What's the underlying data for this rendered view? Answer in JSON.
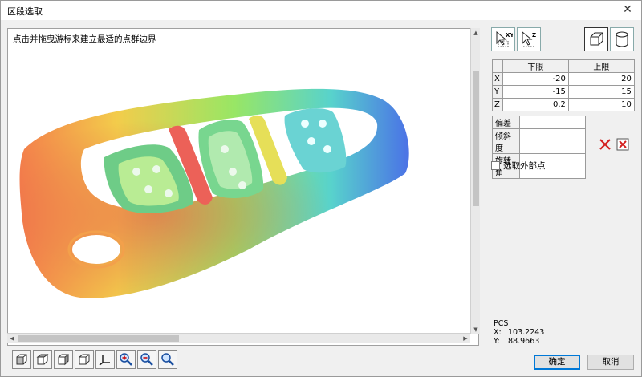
{
  "window": {
    "title": "区段选取",
    "close_glyph": "✕"
  },
  "viewer": {
    "hint": "点击并拖曳游标来建立最适的点群边界"
  },
  "scrollbars": {
    "up": "▲",
    "down": "▼",
    "left": "◀",
    "right": "▶"
  },
  "toolbar": {
    "icons": [
      "cube-front-icon",
      "cube-top-icon",
      "cube-left-icon",
      "cube-iso-icon",
      "axis-icon",
      "zoom-in-icon",
      "zoom-out-icon",
      "zoom-fit-icon"
    ]
  },
  "selection_mode": {
    "xy_label": "XY",
    "z_label": "Z",
    "shape_icons": [
      "cube-shape-icon",
      "cylinder-shape-icon"
    ]
  },
  "limits": {
    "header_lower": "下限",
    "header_upper": "上限",
    "rows": [
      {
        "axis": "X",
        "lower": "-20",
        "upper": "20"
      },
      {
        "axis": "Y",
        "lower": "-15",
        "upper": "15"
      },
      {
        "axis": "Z",
        "lower": "0.2",
        "upper": "10"
      }
    ]
  },
  "params": {
    "rows": [
      {
        "label": "偏差",
        "value": ""
      },
      {
        "label": "倾斜度",
        "value": ""
      },
      {
        "label": "旋转角",
        "value": ""
      }
    ]
  },
  "actions": {
    "delete_icon": "red-x-icon",
    "clear_icon": "red-boxed-x-icon"
  },
  "outside_points": {
    "label": "选取外部点",
    "checked": false
  },
  "coords": {
    "system": "PCS",
    "x_label": "X:",
    "x_value": "103.2243",
    "y_label": "Y:",
    "y_value": "88.9663"
  },
  "buttons": {
    "ok": "确定",
    "cancel": "取消"
  },
  "colors": {
    "accent": "#0078d7",
    "delete_red": "#d42020"
  }
}
